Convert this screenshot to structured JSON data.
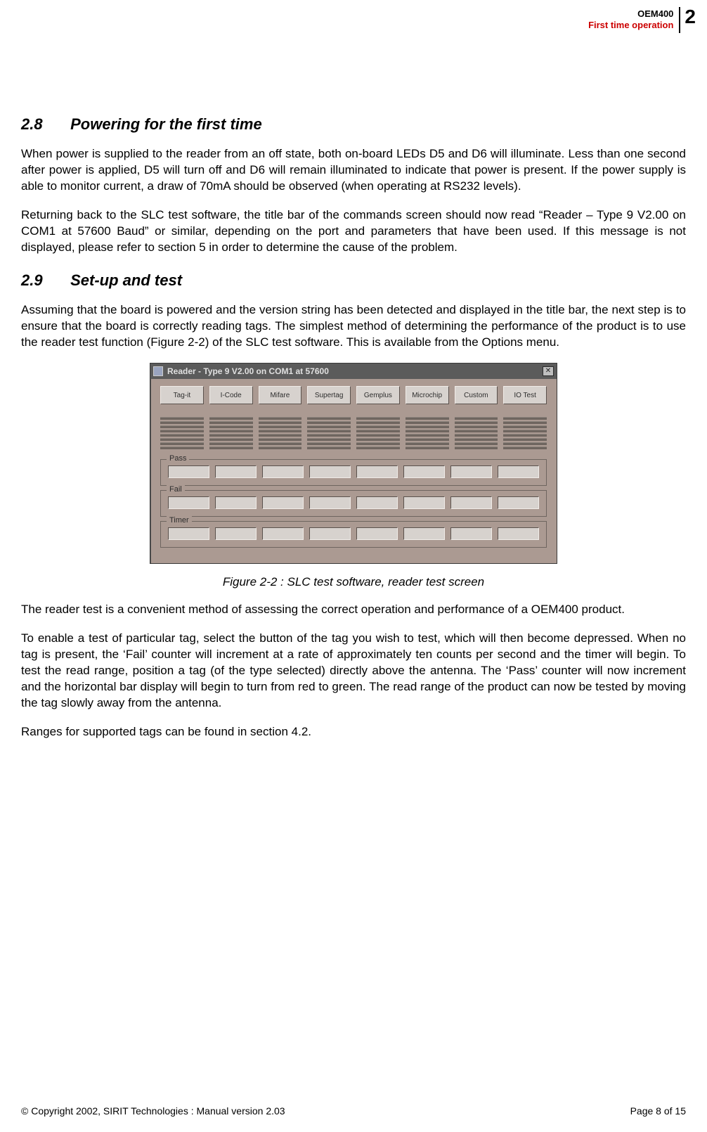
{
  "header": {
    "line1": "OEM400",
    "line2": "First time operation",
    "chapter": "2"
  },
  "sections": {
    "s28": {
      "num": "2.8",
      "title": "Powering for the first time",
      "p1": "When power is supplied to the reader from an off state, both on-board LEDs D5 and D6 will illuminate. Less than one second after power is applied, D5 will turn off and D6 will remain illuminated to indicate that power is present. If the power supply is able to monitor current, a draw of 70mA should be observed (when operating at RS232 levels).",
      "p2": "Returning back to the SLC test software, the title bar of the commands screen should now read “Reader – Type 9 V2.00 on COM1 at 57600 Baud” or similar, depending on the port and parameters that have been used. If this message is not displayed, please refer to section 5 in order to determine the cause of the problem."
    },
    "s29": {
      "num": "2.9",
      "title": "Set-up and test",
      "p1": "Assuming that the board is powered and the version string has been detected and displayed in the title bar, the next step is to ensure that the board is correctly reading tags. The simplest method of determining the performance of the product is to use the reader test function (Figure 2-2) of the SLC test software. This is available from the Options menu.",
      "caption": "Figure 2-2 : SLC test software, reader test screen",
      "p2": "The reader test is a convenient method of assessing the correct operation and performance of a OEM400 product.",
      "p3": "To enable a test of particular tag, select the button of the tag you wish to test, which will then become depressed. When no tag is present, the ‘Fail’ counter will increment at a rate of approximately ten counts per second and the timer will begin. To test the read range, position a tag (of the type selected) directly above the antenna. The ‘Pass’ counter will now increment and the horizontal bar display will begin to turn from red to green. The read range of the product can now be tested by moving the tag slowly away from the antenna.",
      "p4": "Ranges for supported tags can be found in section 4.2."
    }
  },
  "app": {
    "title": "Reader - Type 9 V2.00 on COM1 at 57600",
    "close_glyph": "✕",
    "buttons": [
      "Tag-it",
      "I-Code",
      "Mifare",
      "Supertag",
      "Gemplus",
      "Microchip",
      "Custom",
      "IO Test"
    ],
    "frames": {
      "pass": "Pass",
      "fail": "Fail",
      "timer": "Timer"
    }
  },
  "footer": {
    "left": "© Copyright 2002, SIRIT Technologies : Manual version 2.03",
    "right": "Page 8 of 15"
  }
}
